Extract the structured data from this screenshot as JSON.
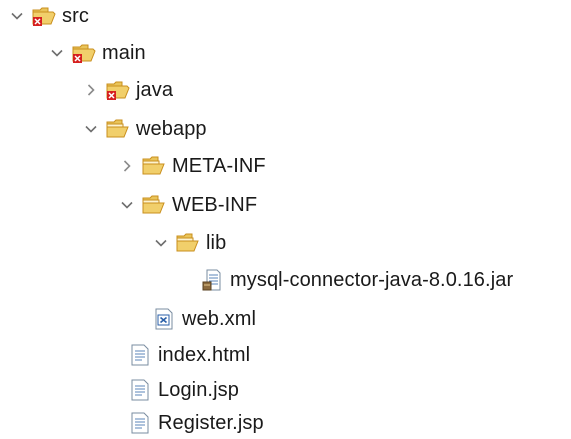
{
  "tree": {
    "src": {
      "label": "src",
      "state": "expanded",
      "icon": "source-folder-error-icon"
    },
    "main": {
      "label": "main",
      "state": "expanded",
      "icon": "source-folder-error-icon"
    },
    "java": {
      "label": "java",
      "state": "collapsed",
      "icon": "source-folder-error-icon"
    },
    "webapp": {
      "label": "webapp",
      "state": "expanded",
      "icon": "folder-open-icon"
    },
    "meta_inf": {
      "label": "META-INF",
      "state": "collapsed",
      "icon": "folder-open-icon"
    },
    "web_inf": {
      "label": "WEB-INF",
      "state": "expanded",
      "icon": "folder-open-icon"
    },
    "lib": {
      "label": "lib",
      "state": "expanded",
      "icon": "folder-open-icon"
    },
    "mysql_jar": {
      "label": "mysql-connector-java-8.0.16.jar",
      "icon": "jar-file-icon"
    },
    "web_xml": {
      "label": "web.xml",
      "icon": "xml-file-icon"
    },
    "index_html": {
      "label": "index.html",
      "icon": "text-file-icon"
    },
    "login_jsp": {
      "label": "Login.jsp",
      "icon": "text-file-icon"
    },
    "register_jsp": {
      "label": "Register.jsp",
      "icon": "text-file-icon"
    }
  },
  "colors": {
    "folder": "#e9c45a",
    "folder_dark": "#c98f1d",
    "error_red": "#d62020",
    "chevron": "#6e6e6e",
    "text": "#1a1a1a"
  }
}
